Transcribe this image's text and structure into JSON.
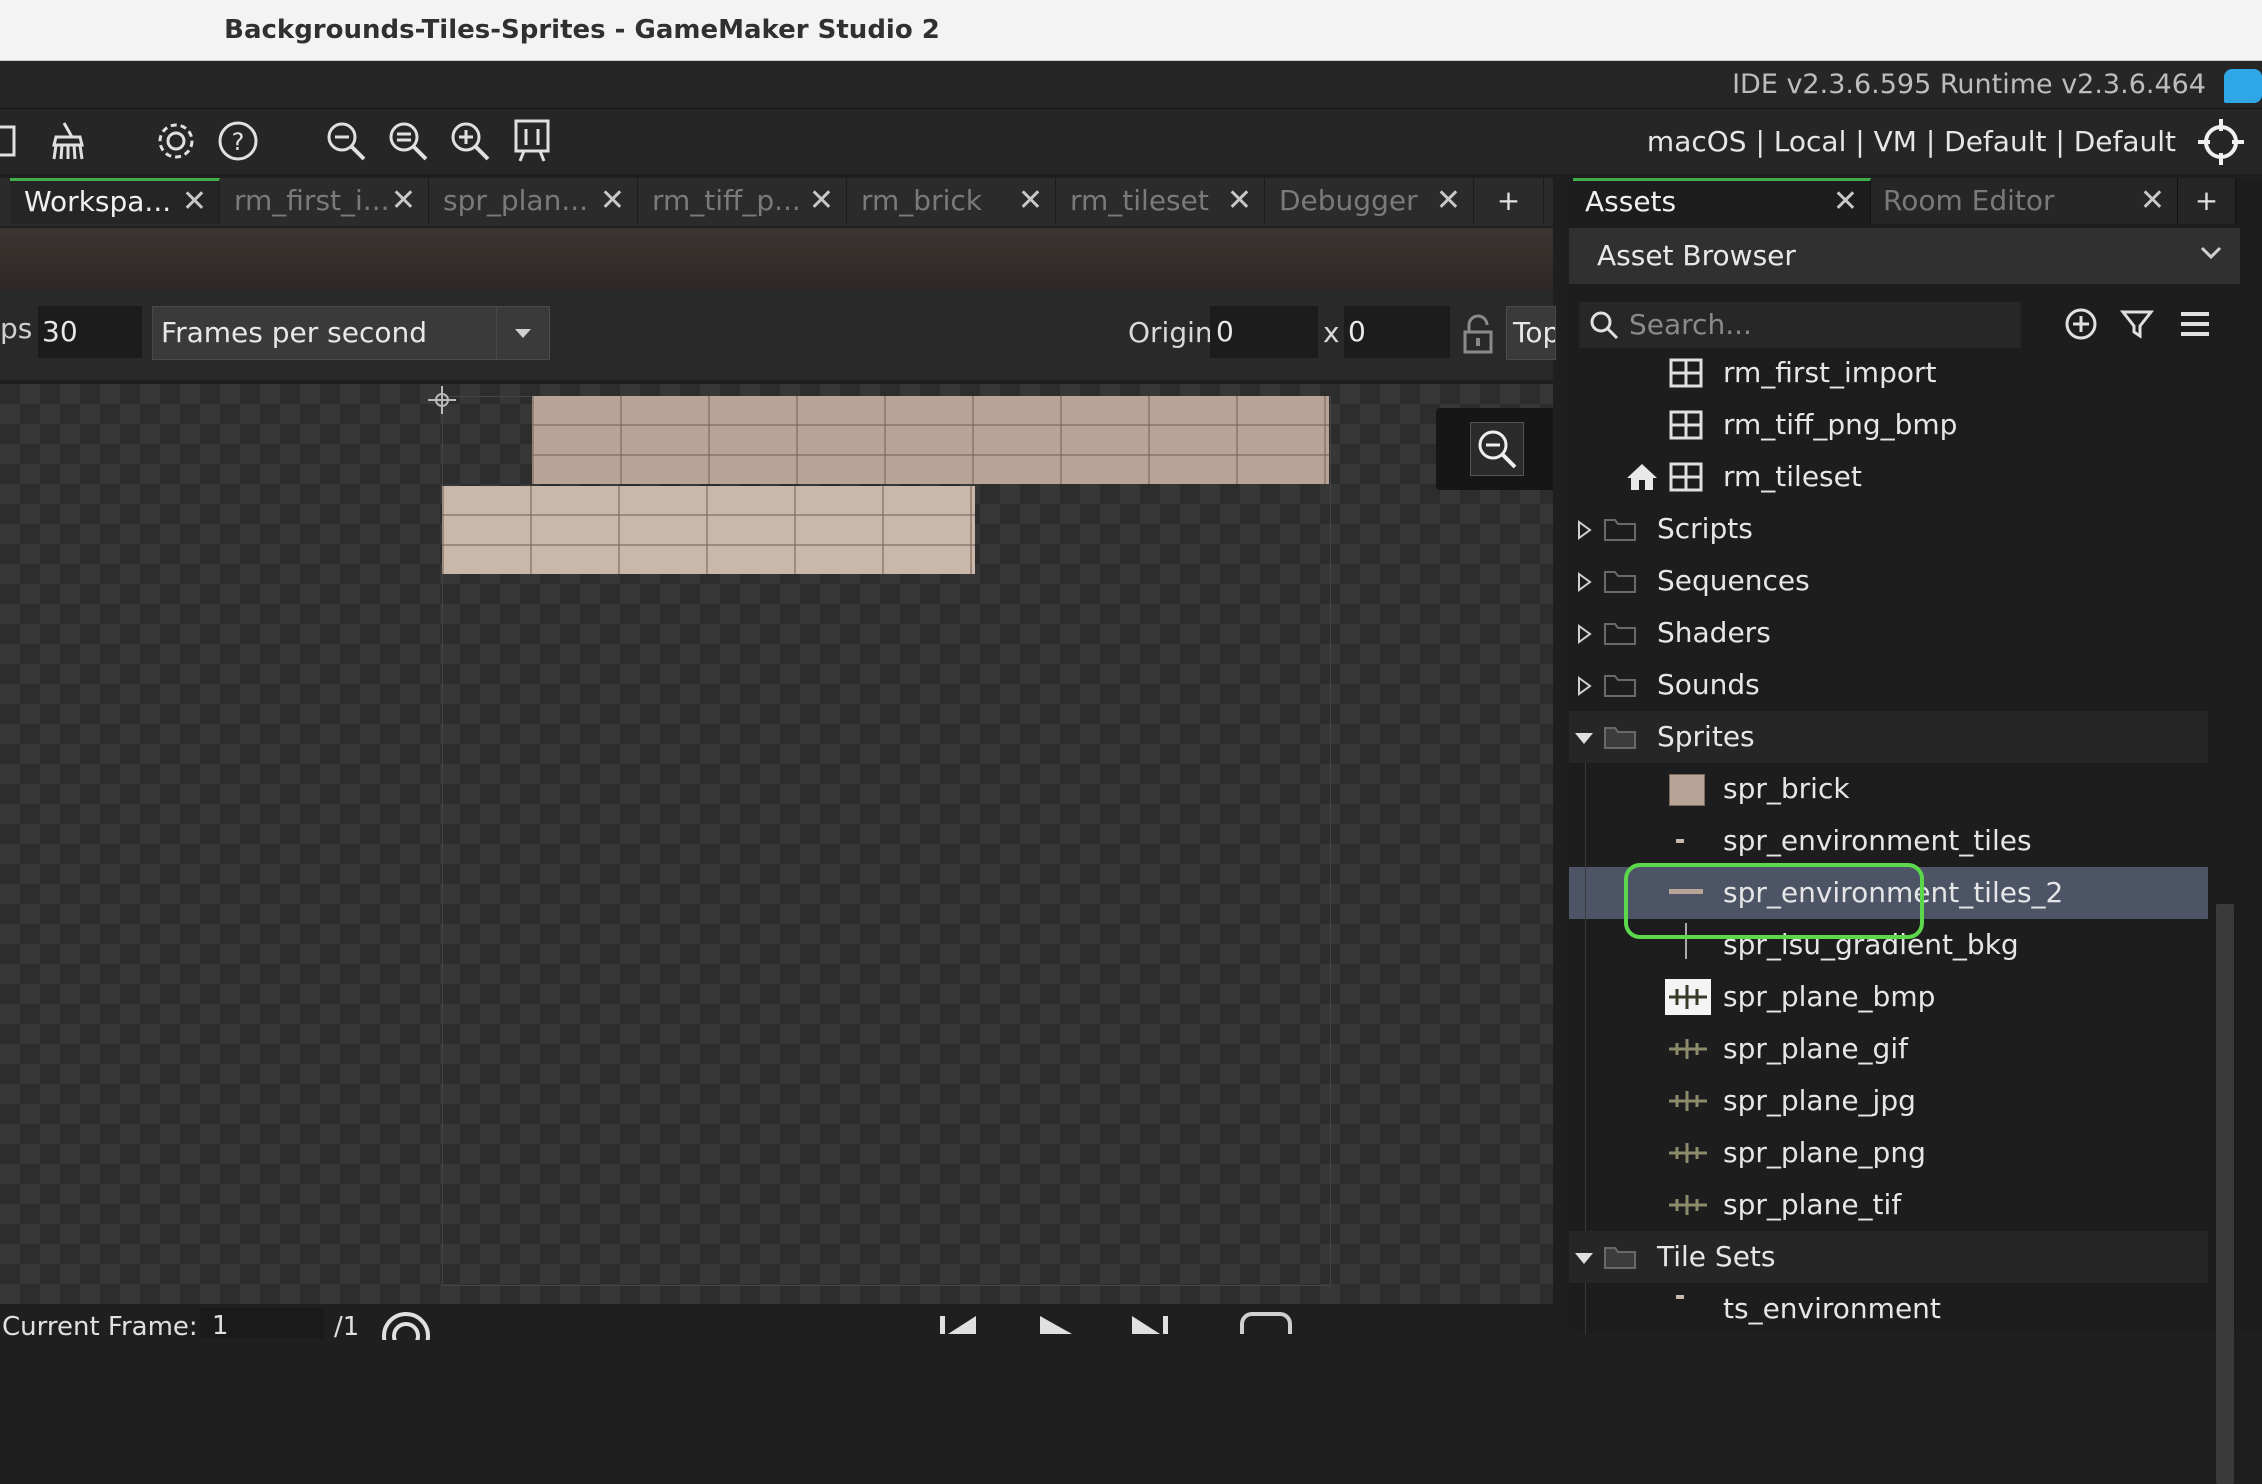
{
  "window": {
    "title": "Backgrounds-Tiles-Sprites - GameMaker Studio 2"
  },
  "version_bar": {
    "text": "IDE v2.3.6.595  Runtime v2.3.6.464"
  },
  "toolbar": {
    "icons": [
      "workspace-icon",
      "clean-brush-icon",
      "gear-icon",
      "help-icon",
      "zoom-out-icon",
      "zoom-reset-icon",
      "zoom-in-icon",
      "device-icon"
    ],
    "target": "macOS | Local | VM | Default | Default"
  },
  "editor_tabs": [
    {
      "label": "Workspa...",
      "active": true
    },
    {
      "label": "rm_first_i...",
      "active": false
    },
    {
      "label": "spr_plan...",
      "active": false
    },
    {
      "label": "rm_tiff_p...",
      "active": false
    },
    {
      "label": "rm_brick",
      "active": false
    },
    {
      "label": "rm_tileset",
      "active": false
    },
    {
      "label": "Debugger",
      "active": false
    },
    {
      "label": "+",
      "active": false
    }
  ],
  "sprite_editor": {
    "fps_label": "ps",
    "fps_value": "30",
    "fps_mode": "Frames per second",
    "origin_label": "Origin",
    "origin_x": "0",
    "x_label": "x",
    "origin_y": "0",
    "origin_preset": "Top"
  },
  "playback": {
    "current_frame_label": "Current Frame:",
    "current_frame": "1",
    "total_frames": "/1"
  },
  "right_panel": {
    "tabs": [
      {
        "label": "Assets",
        "active": true
      },
      {
        "label": "Room Editor",
        "active": false
      },
      {
        "label": "+",
        "active": false
      }
    ],
    "browser_title": "Asset Browser",
    "search_placeholder": "Search...",
    "tree": [
      {
        "label": "rm_first_import",
        "kind": "room",
        "level": 2
      },
      {
        "label": "rm_tiff_png_bmp",
        "kind": "room",
        "level": 2
      },
      {
        "label": "rm_tileset",
        "kind": "room-home",
        "level": 2
      },
      {
        "label": "Scripts",
        "kind": "folder-closed",
        "level": 1
      },
      {
        "label": "Sequences",
        "kind": "folder-closed",
        "level": 1
      },
      {
        "label": "Shaders",
        "kind": "folder-closed",
        "level": 1
      },
      {
        "label": "Sounds",
        "kind": "folder-closed",
        "level": 1
      },
      {
        "label": "Sprites",
        "kind": "folder-open",
        "level": 1
      },
      {
        "label": "spr_brick",
        "kind": "sprite-brick",
        "level": 2
      },
      {
        "label": "spr_environment_tiles",
        "kind": "sprite-small",
        "level": 2
      },
      {
        "label": "spr_environment_tiles_2",
        "kind": "sprite-strip",
        "level": 2,
        "selected": true
      },
      {
        "label": "spr_lsu_gradient_bkg",
        "kind": "sprite-line",
        "level": 2
      },
      {
        "label": "spr_plane_bmp",
        "kind": "sprite-plane-white",
        "level": 2
      },
      {
        "label": "spr_plane_gif",
        "kind": "sprite-plane",
        "level": 2
      },
      {
        "label": "spr_plane_jpg",
        "kind": "sprite-plane",
        "level": 2
      },
      {
        "label": "spr_plane_png",
        "kind": "sprite-plane",
        "level": 2
      },
      {
        "label": "spr_plane_tif",
        "kind": "sprite-plane",
        "level": 2
      },
      {
        "label": "Tile Sets",
        "kind": "folder-open",
        "level": 1
      },
      {
        "label": "ts_environment",
        "kind": "sprite-small",
        "level": 2
      }
    ]
  },
  "colors": {
    "accent_green": "#3fae49",
    "highlight_ring": "#5cd84d",
    "selection": "#4c5466",
    "chat_blue": "#2fa6e6"
  }
}
